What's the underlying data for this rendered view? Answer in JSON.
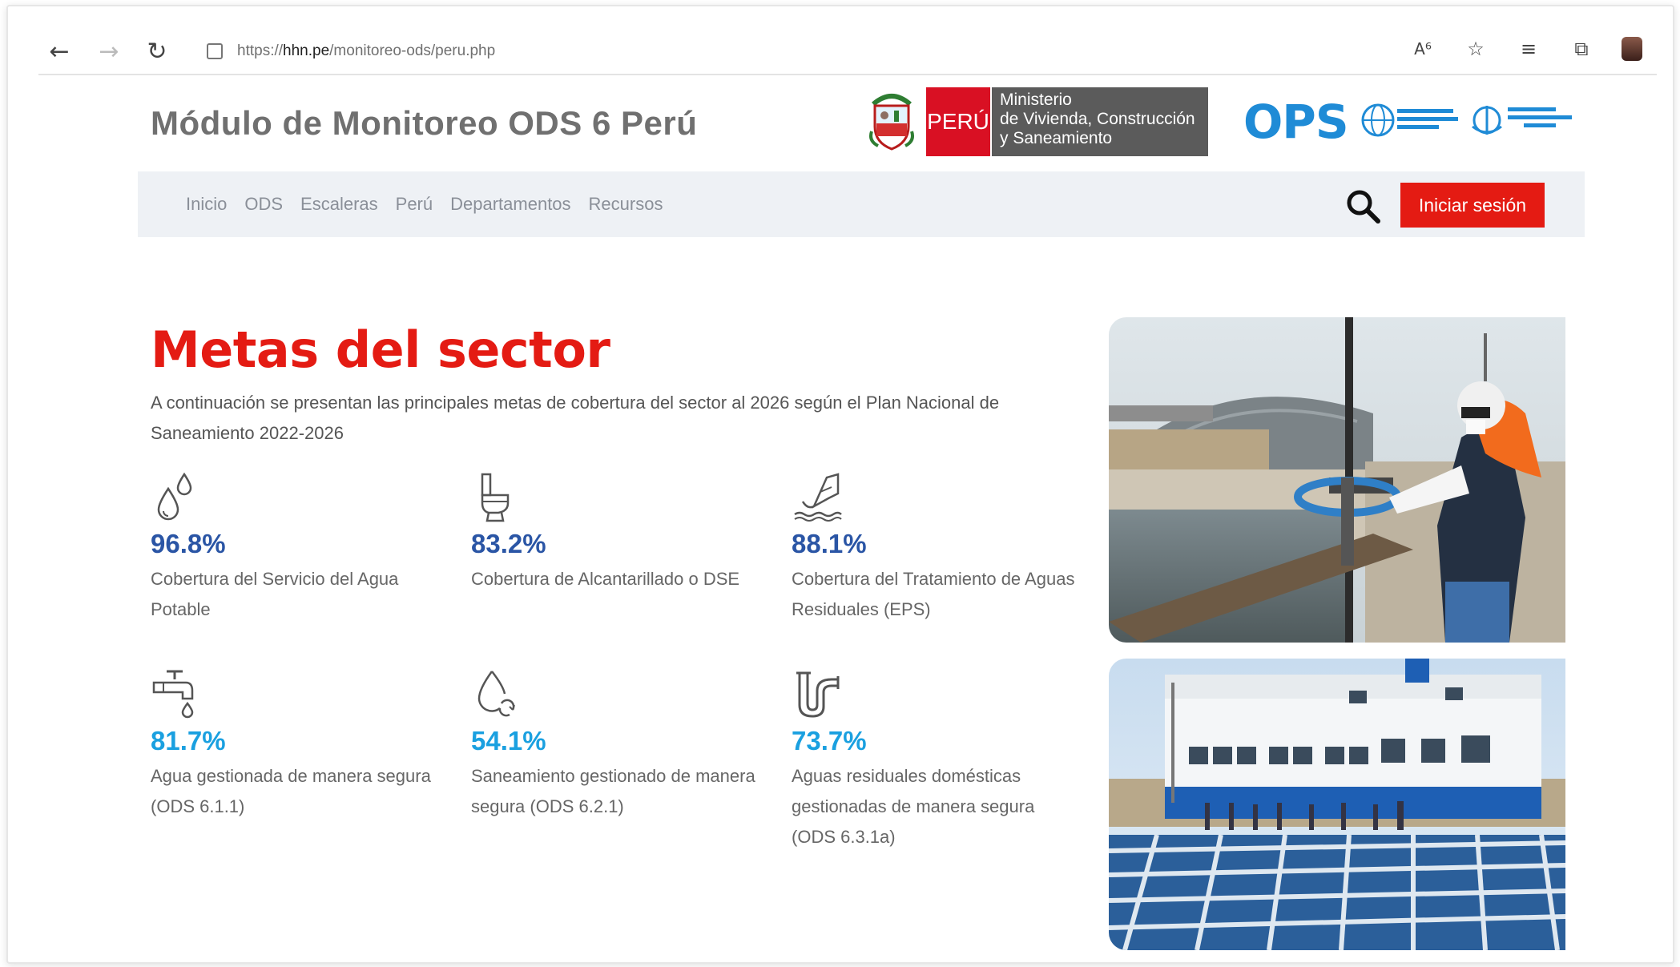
{
  "browser": {
    "url_scheme": "https://",
    "url_host": "hhn.pe",
    "url_path": "/monitoreo-ods/peru.php"
  },
  "header": {
    "site_title": "Módulo de Monitoreo ODS 6 Perú",
    "peru_label": "PERÚ",
    "ministry_line1": "Ministerio",
    "ministry_line2": "de Vivienda, Construcción",
    "ministry_line3": "y Saneamiento",
    "ops_logo": "OPS"
  },
  "nav": {
    "links": [
      "Inicio",
      "ODS",
      "Escaleras",
      "Perú",
      "Departamentos",
      "Recursos"
    ],
    "login_label": "Iniciar sesión"
  },
  "main": {
    "title": "Metas del sector",
    "intro": "A continuación se presentan las principales metas de cobertura del sector al 2026 según el Plan Nacional de Saneamiento 2022-2026",
    "stats": [
      {
        "icon": "water-drops-icon",
        "value": "96.8%",
        "label": "Cobertura del Servicio del Agua Potable",
        "color": "#2a55a5"
      },
      {
        "icon": "toilet-icon",
        "value": "83.2%",
        "label": "Cobertura de Alcantarillado o DSE",
        "color": "#2a55a5"
      },
      {
        "icon": "discharge-pipe-icon",
        "value": "88.1%",
        "label": "Cobertura del Tratamiento de Aguas Residuales (EPS)",
        "color": "#2a55a5"
      },
      {
        "icon": "faucet-icon",
        "value": "81.7%",
        "label": "Agua gestionada de manera segura (ODS 6.1.1)",
        "color": "#1aa0e0"
      },
      {
        "icon": "recycle-drop-icon",
        "value": "54.1%",
        "label": "Saneamiento gestionado de manera segura (ODS 6.2.1)",
        "color": "#1aa0e0"
      },
      {
        "icon": "pipe-icon",
        "value": "73.7%",
        "label": "Aguas residuales domésticas gestionadas de manera segura (ODS 6.3.1a)",
        "color": "#1aa0e0"
      }
    ]
  },
  "colors": {
    "brand_red": "#e41b13",
    "stat_dark_blue": "#2a55a5",
    "stat_light_blue": "#1aa0e0",
    "nav_bg": "#eef1f5"
  }
}
